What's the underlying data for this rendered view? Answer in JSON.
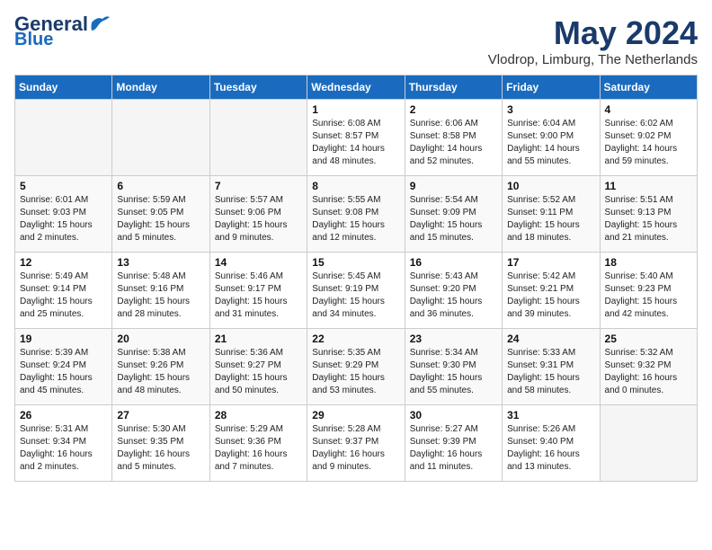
{
  "header": {
    "logo_line1": "General",
    "logo_line2": "Blue",
    "month": "May 2024",
    "location": "Vlodrop, Limburg, The Netherlands"
  },
  "weekdays": [
    "Sunday",
    "Monday",
    "Tuesday",
    "Wednesday",
    "Thursday",
    "Friday",
    "Saturday"
  ],
  "weeks": [
    [
      {
        "day": "",
        "info": ""
      },
      {
        "day": "",
        "info": ""
      },
      {
        "day": "",
        "info": ""
      },
      {
        "day": "1",
        "info": "Sunrise: 6:08 AM\nSunset: 8:57 PM\nDaylight: 14 hours\nand 48 minutes."
      },
      {
        "day": "2",
        "info": "Sunrise: 6:06 AM\nSunset: 8:58 PM\nDaylight: 14 hours\nand 52 minutes."
      },
      {
        "day": "3",
        "info": "Sunrise: 6:04 AM\nSunset: 9:00 PM\nDaylight: 14 hours\nand 55 minutes."
      },
      {
        "day": "4",
        "info": "Sunrise: 6:02 AM\nSunset: 9:02 PM\nDaylight: 14 hours\nand 59 minutes."
      }
    ],
    [
      {
        "day": "5",
        "info": "Sunrise: 6:01 AM\nSunset: 9:03 PM\nDaylight: 15 hours\nand 2 minutes."
      },
      {
        "day": "6",
        "info": "Sunrise: 5:59 AM\nSunset: 9:05 PM\nDaylight: 15 hours\nand 5 minutes."
      },
      {
        "day": "7",
        "info": "Sunrise: 5:57 AM\nSunset: 9:06 PM\nDaylight: 15 hours\nand 9 minutes."
      },
      {
        "day": "8",
        "info": "Sunrise: 5:55 AM\nSunset: 9:08 PM\nDaylight: 15 hours\nand 12 minutes."
      },
      {
        "day": "9",
        "info": "Sunrise: 5:54 AM\nSunset: 9:09 PM\nDaylight: 15 hours\nand 15 minutes."
      },
      {
        "day": "10",
        "info": "Sunrise: 5:52 AM\nSunset: 9:11 PM\nDaylight: 15 hours\nand 18 minutes."
      },
      {
        "day": "11",
        "info": "Sunrise: 5:51 AM\nSunset: 9:13 PM\nDaylight: 15 hours\nand 21 minutes."
      }
    ],
    [
      {
        "day": "12",
        "info": "Sunrise: 5:49 AM\nSunset: 9:14 PM\nDaylight: 15 hours\nand 25 minutes."
      },
      {
        "day": "13",
        "info": "Sunrise: 5:48 AM\nSunset: 9:16 PM\nDaylight: 15 hours\nand 28 minutes."
      },
      {
        "day": "14",
        "info": "Sunrise: 5:46 AM\nSunset: 9:17 PM\nDaylight: 15 hours\nand 31 minutes."
      },
      {
        "day": "15",
        "info": "Sunrise: 5:45 AM\nSunset: 9:19 PM\nDaylight: 15 hours\nand 34 minutes."
      },
      {
        "day": "16",
        "info": "Sunrise: 5:43 AM\nSunset: 9:20 PM\nDaylight: 15 hours\nand 36 minutes."
      },
      {
        "day": "17",
        "info": "Sunrise: 5:42 AM\nSunset: 9:21 PM\nDaylight: 15 hours\nand 39 minutes."
      },
      {
        "day": "18",
        "info": "Sunrise: 5:40 AM\nSunset: 9:23 PM\nDaylight: 15 hours\nand 42 minutes."
      }
    ],
    [
      {
        "day": "19",
        "info": "Sunrise: 5:39 AM\nSunset: 9:24 PM\nDaylight: 15 hours\nand 45 minutes."
      },
      {
        "day": "20",
        "info": "Sunrise: 5:38 AM\nSunset: 9:26 PM\nDaylight: 15 hours\nand 48 minutes."
      },
      {
        "day": "21",
        "info": "Sunrise: 5:36 AM\nSunset: 9:27 PM\nDaylight: 15 hours\nand 50 minutes."
      },
      {
        "day": "22",
        "info": "Sunrise: 5:35 AM\nSunset: 9:29 PM\nDaylight: 15 hours\nand 53 minutes."
      },
      {
        "day": "23",
        "info": "Sunrise: 5:34 AM\nSunset: 9:30 PM\nDaylight: 15 hours\nand 55 minutes."
      },
      {
        "day": "24",
        "info": "Sunrise: 5:33 AM\nSunset: 9:31 PM\nDaylight: 15 hours\nand 58 minutes."
      },
      {
        "day": "25",
        "info": "Sunrise: 5:32 AM\nSunset: 9:32 PM\nDaylight: 16 hours\nand 0 minutes."
      }
    ],
    [
      {
        "day": "26",
        "info": "Sunrise: 5:31 AM\nSunset: 9:34 PM\nDaylight: 16 hours\nand 2 minutes."
      },
      {
        "day": "27",
        "info": "Sunrise: 5:30 AM\nSunset: 9:35 PM\nDaylight: 16 hours\nand 5 minutes."
      },
      {
        "day": "28",
        "info": "Sunrise: 5:29 AM\nSunset: 9:36 PM\nDaylight: 16 hours\nand 7 minutes."
      },
      {
        "day": "29",
        "info": "Sunrise: 5:28 AM\nSunset: 9:37 PM\nDaylight: 16 hours\nand 9 minutes."
      },
      {
        "day": "30",
        "info": "Sunrise: 5:27 AM\nSunset: 9:39 PM\nDaylight: 16 hours\nand 11 minutes."
      },
      {
        "day": "31",
        "info": "Sunrise: 5:26 AM\nSunset: 9:40 PM\nDaylight: 16 hours\nand 13 minutes."
      },
      {
        "day": "",
        "info": ""
      }
    ]
  ]
}
